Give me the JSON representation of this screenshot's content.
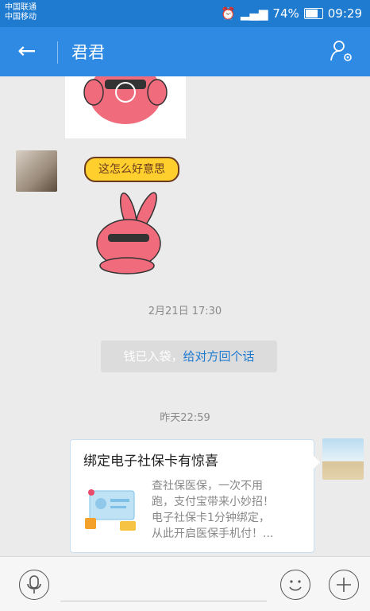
{
  "status_bar": {
    "carrier1": "中国联通",
    "carrier2": "中国移动",
    "battery": "74%",
    "time": "09:29"
  },
  "header": {
    "back_icon": "arrow-left-icon",
    "title": "君君",
    "profile_icon": "user-settings-icon"
  },
  "messages": {
    "sticker_caption": "这怎么好意思",
    "timestamp1": "2月21日 17:30",
    "notice_text": "钱已入袋，",
    "notice_link": "给对方回个话",
    "timestamp2": "昨天22:59"
  },
  "card": {
    "title": "绑定电子社保卡有惊喜",
    "desc_line1": "查社保医保，一次不用",
    "desc_line2": "跑，支付宝带来小妙招！",
    "desc_line3": "电子社保卡1分钟绑定，",
    "desc_line4": "从此开启医保手机付！..."
  },
  "input_bar": {
    "voice_icon": "microphone-icon",
    "emoji_icon": "smiley-icon",
    "add_icon": "plus-icon"
  },
  "colors": {
    "status_bar": "#1e7bd0",
    "header": "#2f8ae3",
    "link": "#1e7bd0"
  }
}
